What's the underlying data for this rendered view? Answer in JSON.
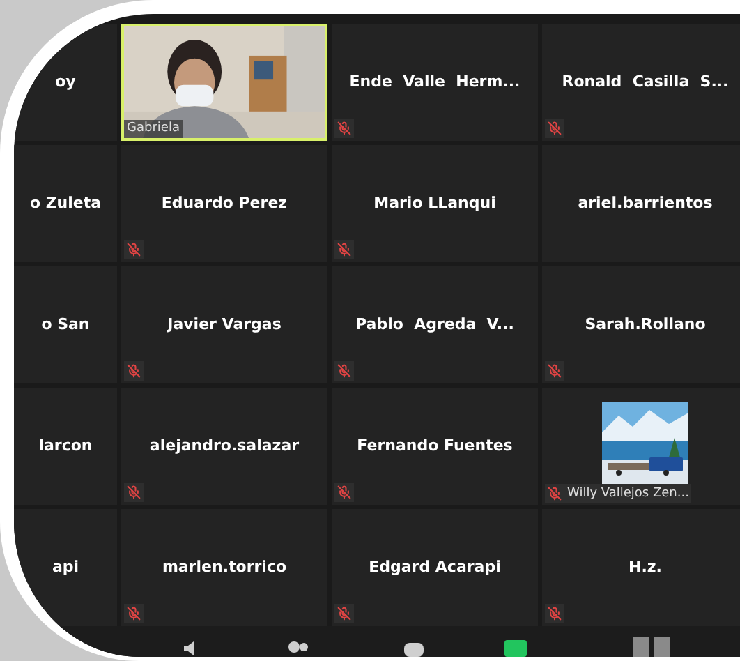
{
  "tiles": [
    {
      "kind": "name",
      "name": "oy",
      "muted": false,
      "speaking": false
    },
    {
      "kind": "video",
      "name": "Gabriela",
      "muted": false,
      "speaking": true
    },
    {
      "kind": "name",
      "name": "Ende  Valle  Herm...",
      "muted": true,
      "speaking": false
    },
    {
      "kind": "name",
      "name": "Ronald  Casilla  S...",
      "muted": true,
      "speaking": false
    },
    {
      "kind": "name",
      "name": "o Zuleta",
      "muted": false,
      "speaking": false
    },
    {
      "kind": "name",
      "name": "Eduardo Perez",
      "muted": true,
      "speaking": false
    },
    {
      "kind": "name",
      "name": "Mario LLanqui",
      "muted": true,
      "speaking": false
    },
    {
      "kind": "name",
      "name": "ariel.barrientos",
      "muted": false,
      "speaking": false
    },
    {
      "kind": "name",
      "name": "o San",
      "muted": false,
      "speaking": false
    },
    {
      "kind": "name",
      "name": "Javier Vargas",
      "muted": true,
      "speaking": false
    },
    {
      "kind": "name",
      "name": "Pablo  Agreda  V...",
      "muted": true,
      "speaking": false
    },
    {
      "kind": "name",
      "name": "Sarah.Rollano",
      "muted": true,
      "speaking": false
    },
    {
      "kind": "name",
      "name": "larcon",
      "muted": false,
      "speaking": false
    },
    {
      "kind": "name",
      "name": "alejandro.salazar",
      "muted": true,
      "speaking": false
    },
    {
      "kind": "name",
      "name": "Fernando Fuentes",
      "muted": true,
      "speaking": false
    },
    {
      "kind": "avatar",
      "name": "Willy Vallejos Zen...",
      "muted": true,
      "speaking": false
    },
    {
      "kind": "name",
      "name": "api",
      "muted": false,
      "speaking": false
    },
    {
      "kind": "name",
      "name": "marlen.torrico",
      "muted": true,
      "speaking": false
    },
    {
      "kind": "name",
      "name": "Edgard Acarapi",
      "muted": true,
      "speaking": false
    },
    {
      "kind": "name",
      "name": "H.z.",
      "muted": true,
      "speaking": false
    }
  ]
}
